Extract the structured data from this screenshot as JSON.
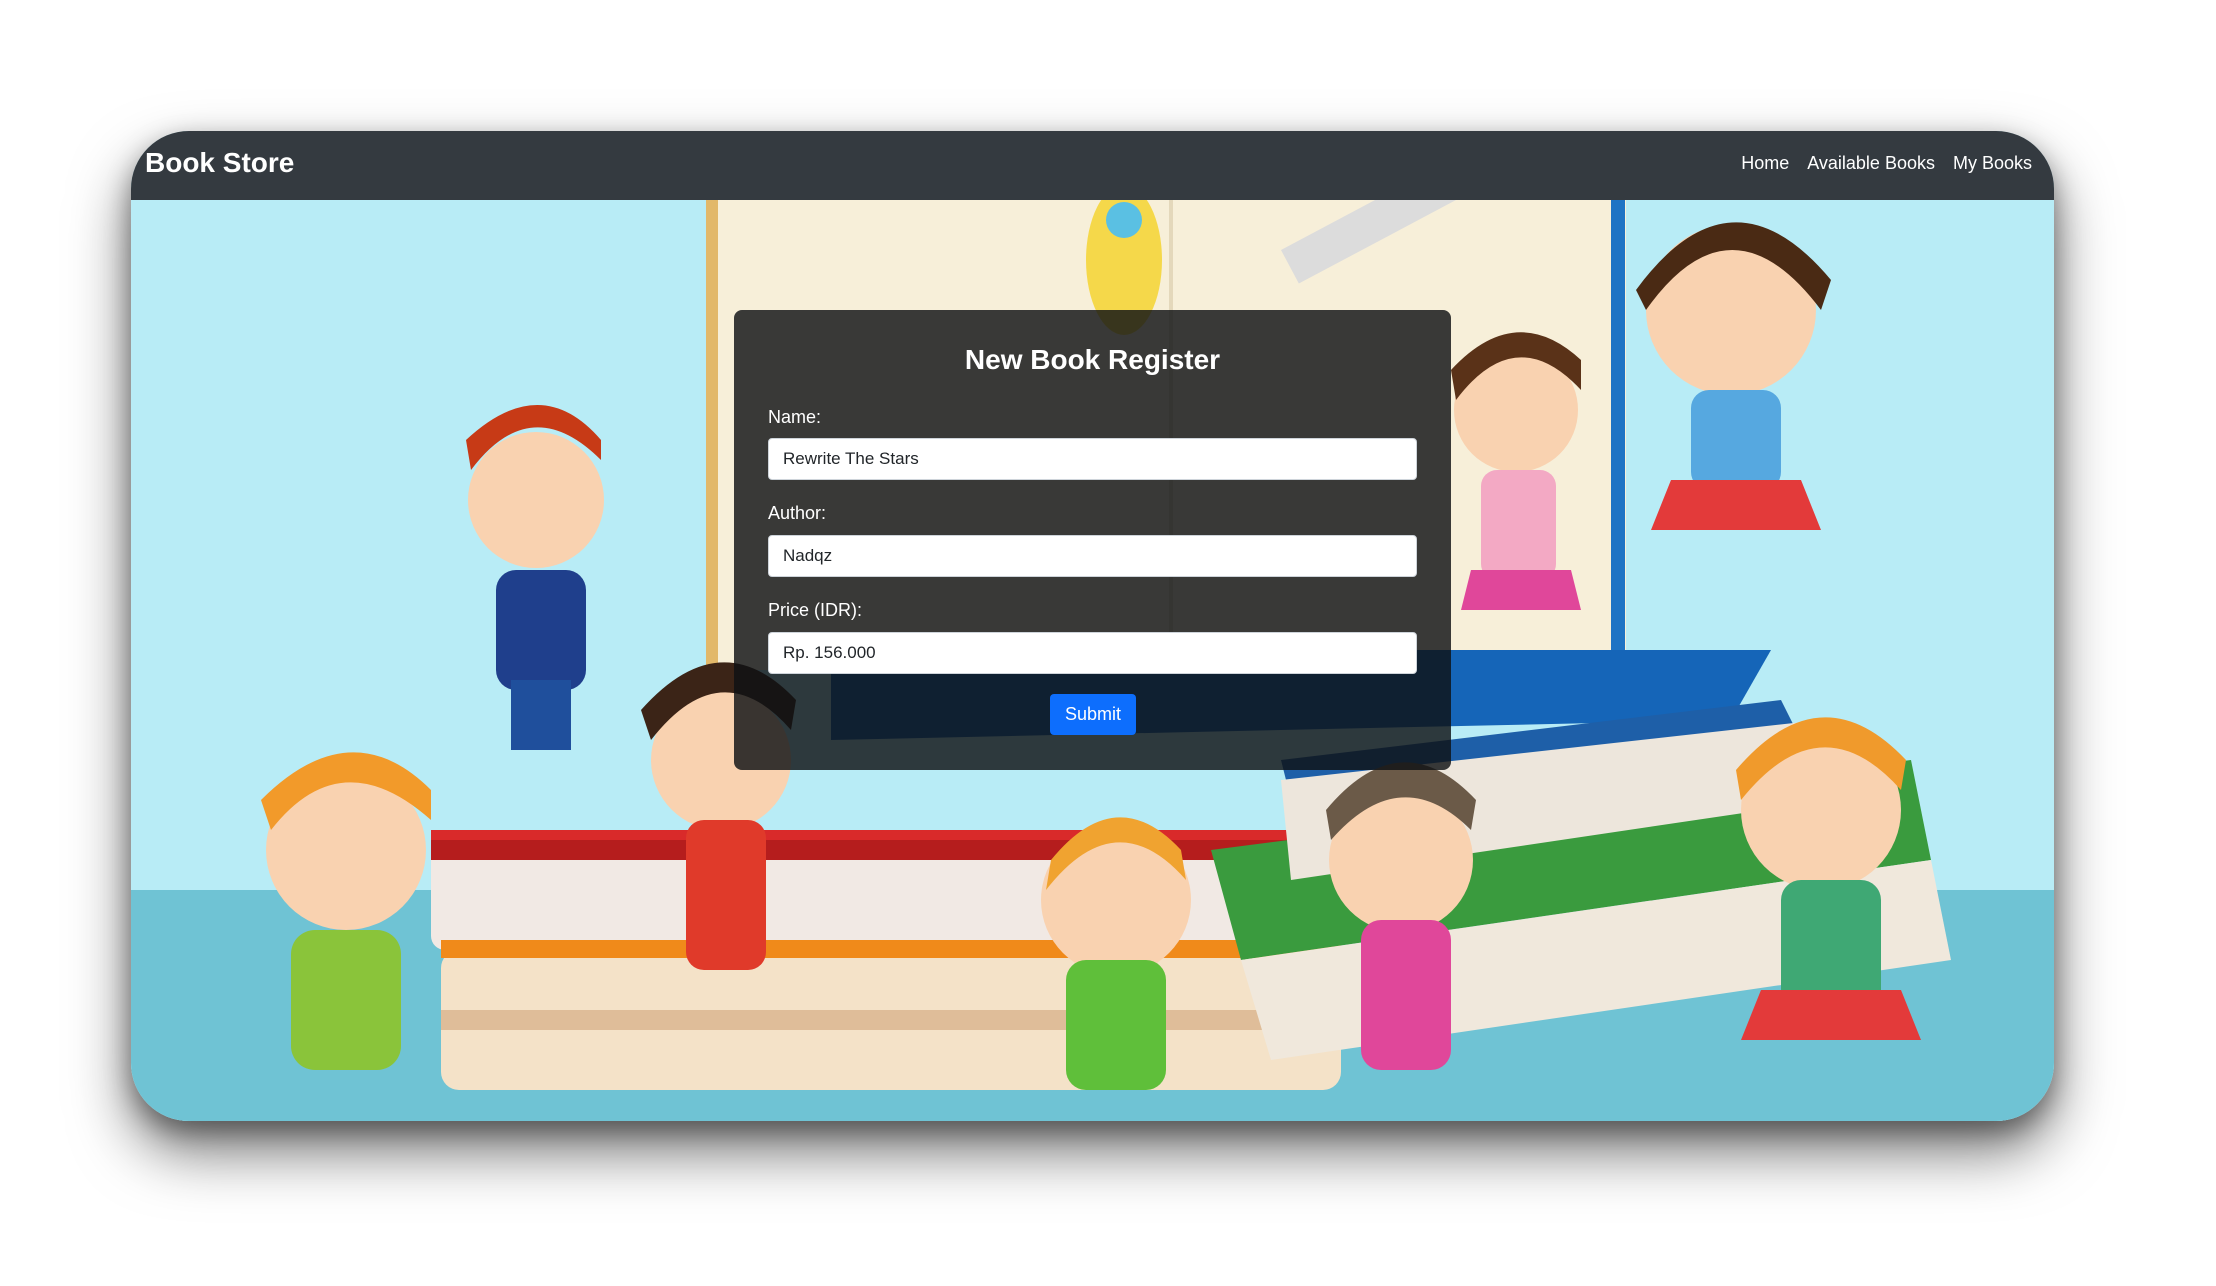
{
  "navbar": {
    "brand": "Book Store",
    "links": [
      "Home",
      "Available Books",
      "My Books"
    ]
  },
  "form": {
    "title": "New Book Register",
    "name_label": "Name:",
    "name_value": "Rewrite The Stars",
    "author_label": "Author:",
    "author_value": "Nadqz",
    "price_label": "Price (IDR):",
    "price_value": "Rp. 156.000",
    "submit_label": "Submit"
  },
  "colors": {
    "navbar_bg": "#343a40",
    "submit_bg": "#0d6efd",
    "hero_sky": "#b8ecf6",
    "hero_floor": "#6fc3d4"
  },
  "background_image": "children-reading-books-illustration"
}
